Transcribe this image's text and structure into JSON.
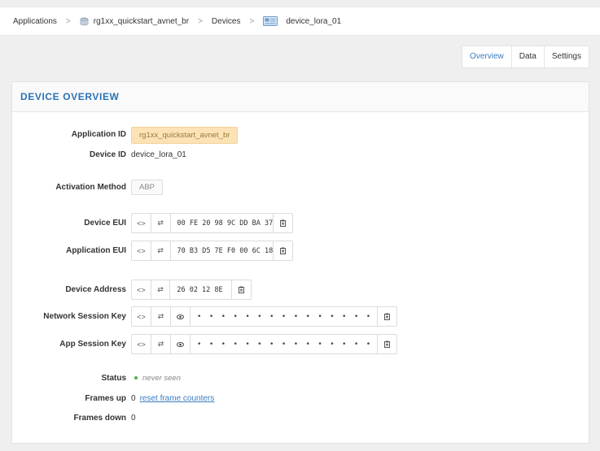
{
  "breadcrumb": {
    "applications": "Applications",
    "application": "rg1xx_quickstart_avnet_br",
    "devices": "Devices",
    "device": "device_lora_01",
    "separator": ">"
  },
  "tabs": {
    "overview": "Overview",
    "data": "Data",
    "settings": "Settings",
    "active": "Overview"
  },
  "card": {
    "title": "DEVICE OVERVIEW"
  },
  "fields": {
    "application_id_label": "Application ID",
    "application_id": "rg1xx_quickstart_avnet_br",
    "device_id_label": "Device ID",
    "device_id": "device_lora_01",
    "activation_method_label": "Activation Method",
    "activation_method": "ABP",
    "device_eui_label": "Device EUI",
    "device_eui": "00 FE 20 98 9C DD BA 37",
    "application_eui_label": "Application EUI",
    "application_eui": "70 B3 D5 7E F0 00 6C 18",
    "device_address_label": "Device Address",
    "device_address": "26 02 12 8E",
    "nwk_session_key_label": "Network Session Key",
    "nwk_session_key": "• • • • • • • • • • • • • • • • • • • • • • • • • • • • • • • •",
    "app_session_key_label": "App Session Key",
    "app_session_key": "• • • • • • • • • • • • • • • • • • • • • • • • • • • • • • • •",
    "status_label": "Status",
    "status": "never seen",
    "frames_up_label": "Frames up",
    "frames_up": "0",
    "reset_link": "reset frame counters",
    "frames_down_label": "Frames down",
    "frames_down": "0"
  },
  "icons": {
    "toggle_format": "<>",
    "byte_order": "⇄",
    "show": "◉",
    "copy": "copy-icon"
  },
  "colors": {
    "accent": "#2a73b6",
    "status_green": "#4caf50",
    "app_id_badge": "#fbe3b6"
  }
}
